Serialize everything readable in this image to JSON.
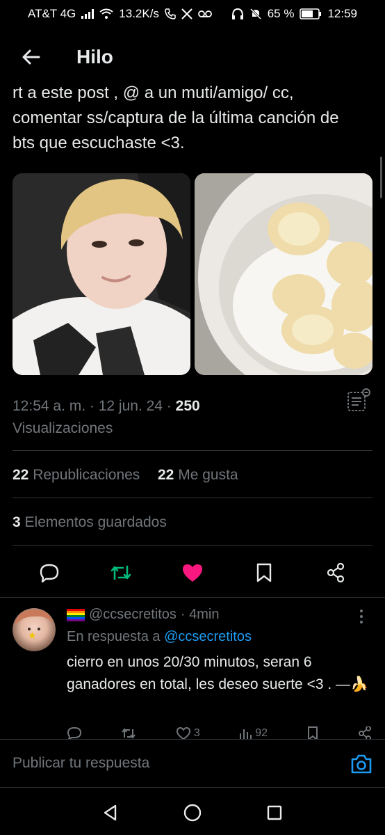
{
  "status_bar": {
    "carrier": "AT&T 4G",
    "speed": "13.2K/s",
    "battery": "65 %",
    "time": "12:59"
  },
  "header": {
    "title": "Hilo"
  },
  "post": {
    "text": "rt a este post , @ a un muti/amigo/ cc, comentar ss/captura de la última canción de bts que escuchaste <3.",
    "timestamp": "12:54 a. m. · 12 jun. 24 · ",
    "views_count": "250",
    "views_label": "Visualizaciones",
    "reposts_count": "22",
    "reposts_label": "Republicaciones",
    "likes_count": "22",
    "likes_label": "Me gusta",
    "saves_count": "3",
    "saves_label": "Elementos guardados",
    "colors": {
      "repost": "#00ba7c",
      "like": "#f91880"
    }
  },
  "reply": {
    "handle": "@ccsecretitos",
    "time": "· 4min",
    "in_reply_prefix": "En respuesta a ",
    "in_reply_handle": "@ccsecretitos",
    "text": "cierro en unos 20/30 minutos, seran 6 ganadores en total, les deseo suerte <3 . —🍌",
    "likes": "3",
    "views": "92"
  },
  "composer": {
    "placeholder": "Publicar tu respuesta"
  },
  "icons": [
    "back-arrow-icon",
    "analytics-icon",
    "reply-icon",
    "repost-icon",
    "heart-icon",
    "bookmark-icon",
    "share-icon",
    "more-icon",
    "camera-icon",
    "nav-back-icon",
    "nav-home-icon",
    "nav-recents-icon"
  ]
}
